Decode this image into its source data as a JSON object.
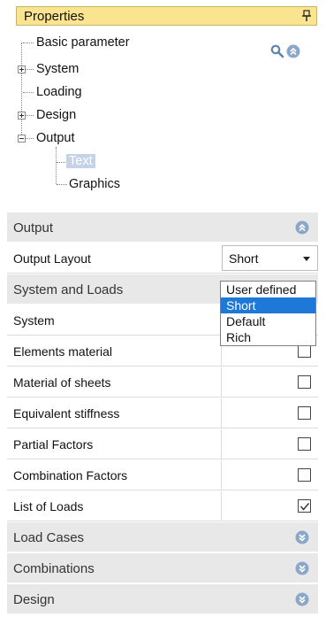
{
  "properties": {
    "title": "Properties"
  },
  "tree": {
    "items": [
      {
        "label": "Basic parameter",
        "expander": "none"
      },
      {
        "label": "System",
        "expander": "plus"
      },
      {
        "label": "Loading",
        "expander": "none"
      },
      {
        "label": "Design",
        "expander": "plus"
      },
      {
        "label": "Output",
        "expander": "minus"
      },
      {
        "label": "Text",
        "selected": true
      },
      {
        "label": "Graphics"
      }
    ]
  },
  "grid": {
    "output_section": "Output",
    "output_layout_label": "Output Layout",
    "output_layout_value": "Short",
    "system_loads_section": "System and Loads",
    "rows": [
      {
        "label": "System",
        "checked": false
      },
      {
        "label": "Elements material",
        "checked": false
      },
      {
        "label": "Material of sheets",
        "checked": false
      },
      {
        "label": "Equivalent stiffness",
        "checked": false
      },
      {
        "label": "Partial Factors",
        "checked": false
      },
      {
        "label": "Combination Factors",
        "checked": false
      },
      {
        "label": "List of Loads",
        "checked": true
      }
    ],
    "collapsed_sections": [
      "Load Cases",
      "Combinations",
      "Design"
    ]
  },
  "dropdown": {
    "options": [
      "User defined",
      "Short",
      "Default",
      "Rich"
    ],
    "selected": "Short"
  },
  "colors": {
    "header": "#fbe48f",
    "section": "#e8e8e8",
    "accent": "#1e78d7",
    "icon": "#8aa7c9"
  }
}
